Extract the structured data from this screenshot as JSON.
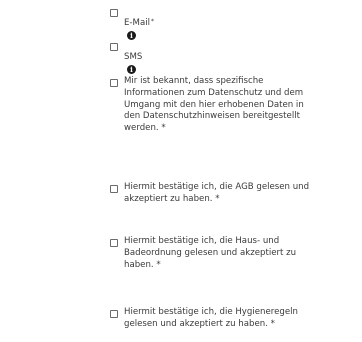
{
  "consent_form": {
    "email": {
      "label": "E-Mail",
      "marker": "*",
      "info_glyph": "i",
      "checked": false
    },
    "sms": {
      "label": "SMS",
      "info_glyph": "i",
      "checked": false
    },
    "privacy": {
      "label": "Mir ist bekannt, dass spezifische\nInformationen zum Datenschutz und dem\nUmgang mit den hier erhobenen Daten in\nden Datenschutzhinweisen bereitgestellt\nwerden. *",
      "checked": false
    },
    "agb": {
      "label": "Hiermit bestätige ich, die AGB gelesen und\nakzeptiert zu haben. *",
      "checked": false
    },
    "house_rules": {
      "label": "Hiermit bestätige ich, die Haus- und\nBadeordnung gelesen und akzeptiert zu\nhaben. *",
      "checked": false
    },
    "hygiene": {
      "label": "Hiermit bestätige ich, die Hygieneregeln\ngelesen und akzeptiert zu haben. *",
      "checked": false
    }
  }
}
